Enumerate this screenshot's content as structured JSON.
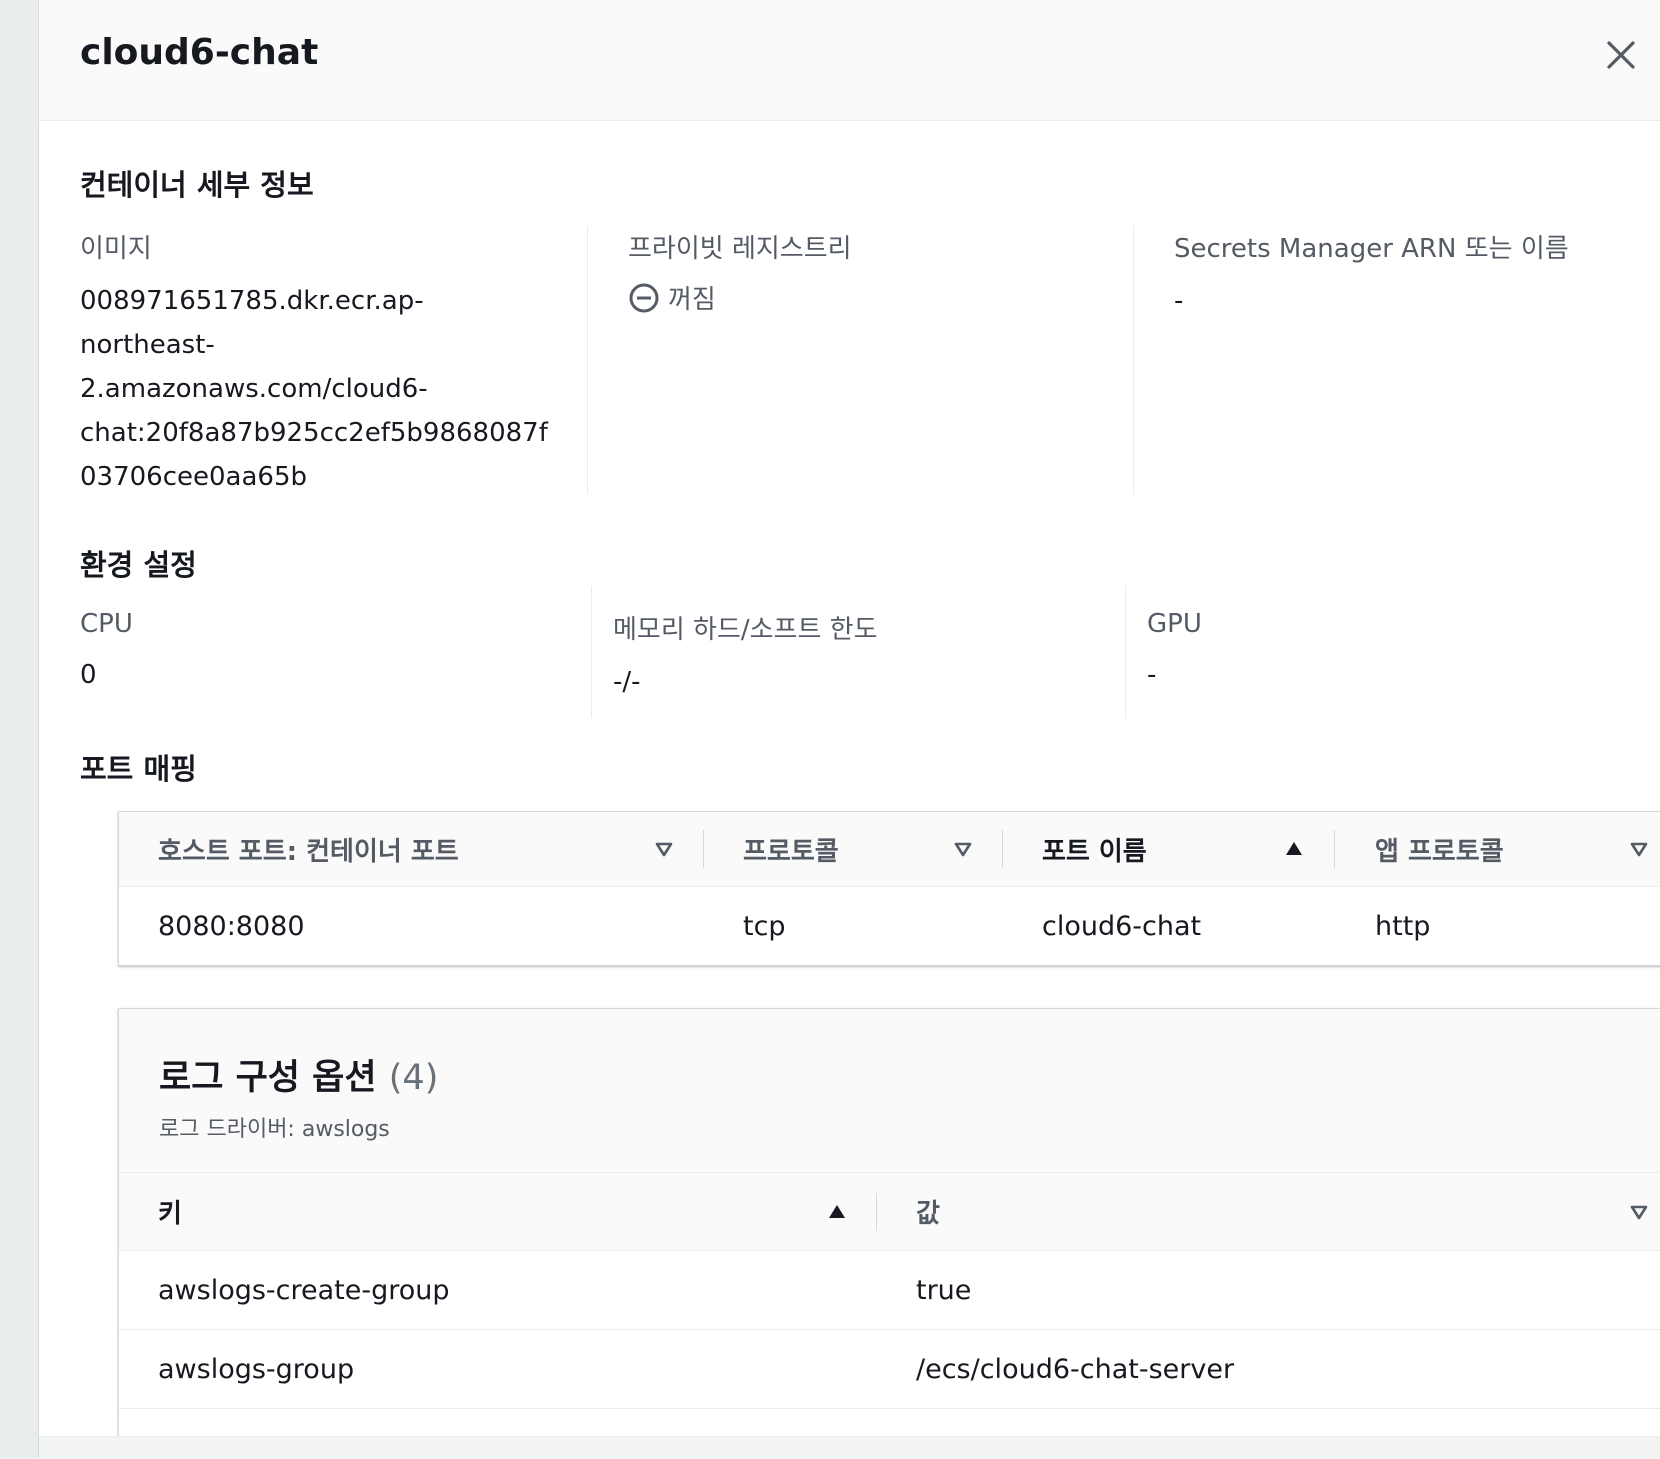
{
  "panel": {
    "title": "cloud6-chat"
  },
  "container_details": {
    "heading": "컨테이너 세부 정보",
    "image_label": "이미지",
    "image_lines": [
      "008971651785.dkr.ecr.ap-",
      "northeast-",
      "2.amazonaws.com/cloud6-",
      "chat:20f8a87b925cc2ef5b9868087f",
      "03706cee0aa65b"
    ],
    "private_registry_label": "프라이빗 레지스트리",
    "private_registry_value": "꺼짐",
    "secrets_label": "Secrets Manager ARN 또는 이름",
    "secrets_value": "-"
  },
  "environment": {
    "heading": "환경 설정",
    "cpu_label": "CPU",
    "cpu_value": "0",
    "memory_label": "메모리 하드/소프트 한도",
    "memory_value": "-/-",
    "gpu_label": "GPU",
    "gpu_value": "-"
  },
  "port_mapping": {
    "heading": "포트 매핑",
    "columns": [
      "호스트 포트: 컨테이너 포트",
      "프로토콜",
      "포트 이름",
      "앱 프로토콜"
    ],
    "rows": [
      [
        "8080:8080",
        "tcp",
        "cloud6-chat",
        "http"
      ]
    ]
  },
  "log_config": {
    "title": "로그 구성 옵션",
    "count": "(4)",
    "subtitle": "로그 드라이버: awslogs",
    "columns": [
      "키",
      "값"
    ],
    "rows": [
      [
        "awslogs-create-group",
        "true"
      ],
      [
        "awslogs-group",
        "/ecs/cloud6-chat-server"
      ]
    ]
  },
  "colors": {
    "text": "#16191f",
    "label": "#545b64",
    "border": "#eaeded"
  },
  "icons": [
    "close-icon",
    "status-off-icon",
    "sort-descending-icon",
    "sort-ascending-icon"
  ]
}
